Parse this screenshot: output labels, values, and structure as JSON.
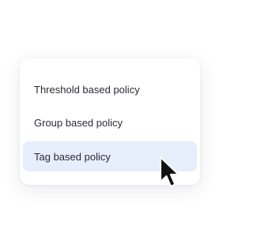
{
  "menu": {
    "items": [
      {
        "label": "Threshold based policy",
        "selected": false
      },
      {
        "label": "Group based policy",
        "selected": false
      },
      {
        "label": "Tag based policy",
        "selected": true
      }
    ]
  },
  "colors": {
    "selected_background": "#e6edfb",
    "text": "#2b2b36",
    "card_background": "#ffffff"
  },
  "icons": {
    "cursor": "mouse-pointer-icon"
  }
}
